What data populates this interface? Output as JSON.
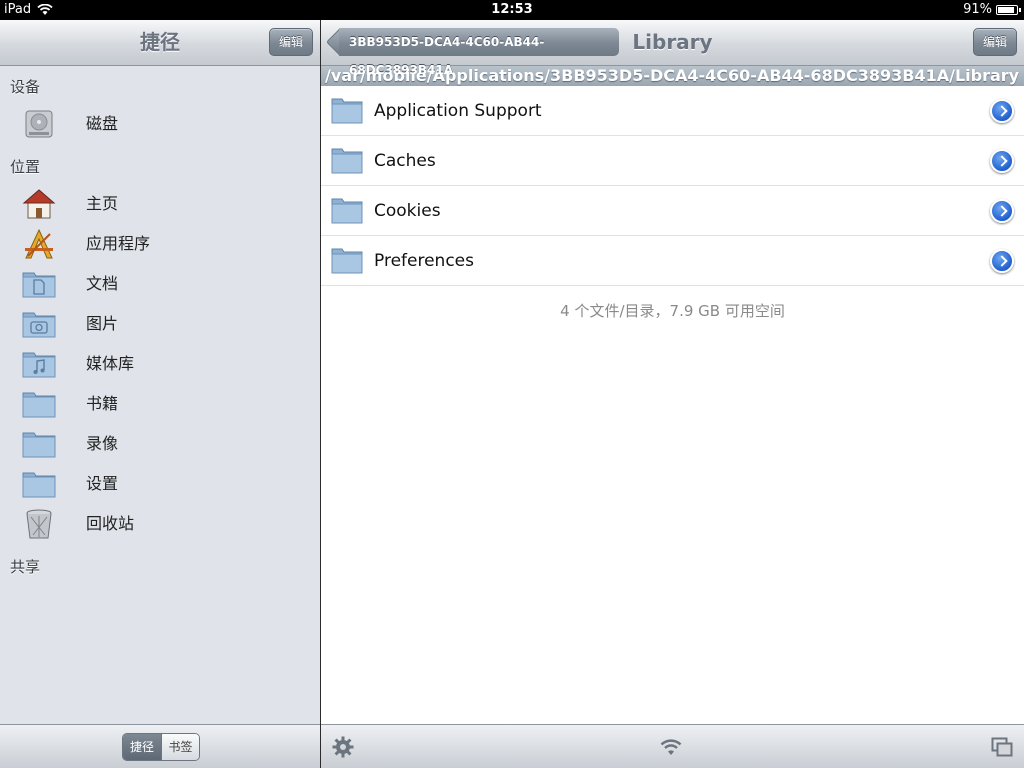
{
  "status": {
    "device": "iPad",
    "time": "12:53",
    "battery": "91%",
    "battery_level": 0.91
  },
  "left": {
    "title": "捷径",
    "edit_label": "编辑",
    "sections": {
      "devices": "设备",
      "places": "位置",
      "shared": "共享"
    },
    "devices": [
      {
        "label": "磁盘",
        "icon": "hard-disk-icon"
      }
    ],
    "places": [
      {
        "label": "主页",
        "icon": "home-icon"
      },
      {
        "label": "应用程序",
        "icon": "applications-icon"
      },
      {
        "label": "文档",
        "icon": "documents-folder-icon"
      },
      {
        "label": "图片",
        "icon": "pictures-folder-icon"
      },
      {
        "label": "媒体库",
        "icon": "music-folder-icon"
      },
      {
        "label": "书籍",
        "icon": "folder-icon"
      },
      {
        "label": "录像",
        "icon": "folder-icon"
      },
      {
        "label": "设置",
        "icon": "folder-icon"
      },
      {
        "label": "回收站",
        "icon": "trash-icon"
      }
    ],
    "segment": {
      "shortcuts": "捷径",
      "bookmarks": "书签"
    }
  },
  "right": {
    "back_label": "3BB953D5-DCA4-4C60-AB44-68DC3893B41A",
    "title": "Library",
    "edit_label": "编辑",
    "path": "/var/mobile/Applications/3BB953D5-DCA4-4C60-AB44-68DC3893B41A/Library",
    "files": [
      {
        "name": "Application Support"
      },
      {
        "name": "Caches"
      },
      {
        "name": "Cookies"
      },
      {
        "name": "Preferences"
      }
    ],
    "summary": "4 个文件/目录，7.9 GB 可用空间"
  }
}
